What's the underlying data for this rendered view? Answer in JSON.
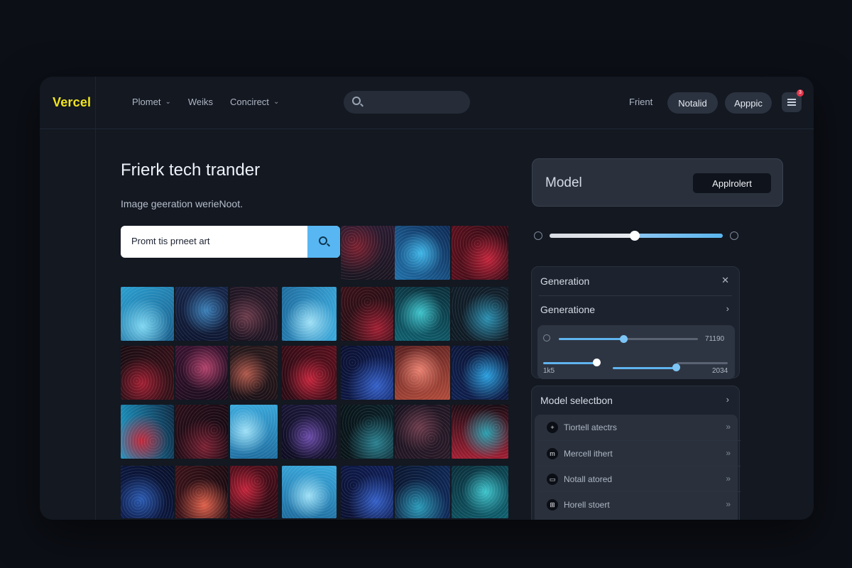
{
  "brand": {
    "name": "Vercel",
    "accent": "#f2e51d"
  },
  "nav": {
    "items": [
      {
        "label": "Plomet",
        "has_menu": true
      },
      {
        "label": "Weiks",
        "has_menu": false
      },
      {
        "label": "Concirect",
        "has_menu": true
      }
    ],
    "chevron": "⌄"
  },
  "header": {
    "search_icon": "search-icon",
    "link_label": "Frient",
    "buttons": [
      {
        "label": "Notalid"
      },
      {
        "label": "Apppic"
      }
    ],
    "menu_badge": "3"
  },
  "hero": {
    "title": "Frierk tech trander",
    "subtitle": "Image geeration werieNoot."
  },
  "prompt": {
    "value": "Promt tis prneet art",
    "submit_icon": "search-icon"
  },
  "gallery": {
    "tiles": [
      "dark-red",
      "cyan-blue",
      "crimson",
      "cyan",
      "navy-cyan",
      "plum",
      "sky",
      "red-dark",
      "teal",
      "dark-cyan",
      "red-dark",
      "magenta",
      "copper",
      "crimson",
      "navy-blue",
      "coral",
      "blue-cyan",
      "red-cyan",
      "maroon",
      "sky",
      "violet",
      "teal-dark",
      "plum",
      "red-teal",
      "navy",
      "coral-red",
      "crimson",
      "sky",
      "navy-blue",
      "blue-teal",
      "teal"
    ]
  },
  "model_card": {
    "label": "Model",
    "button_label": "Applrolert"
  },
  "range": {
    "value": 0.49
  },
  "panel": {
    "rows": [
      {
        "label": "Generation",
        "icon": "close-icon",
        "glyph": "✕"
      },
      {
        "label": "Generatione",
        "icon": "chevron-right-icon",
        "glyph": "›"
      }
    ],
    "slider_1": {
      "value": 0.46,
      "label": "71190"
    },
    "slider_2": {
      "value": 0.6,
      "label": "1k5"
    },
    "slider_3": {
      "value": 0.55,
      "label": "2034"
    }
  },
  "model_selection": {
    "title": "Model selectbon",
    "chevron": "›",
    "items": [
      {
        "icon_glyph": "+",
        "label": "Tiortell atectrs",
        "chevron": "»"
      },
      {
        "icon_glyph": "m",
        "label": "Mercell ithert",
        "chevron": "»"
      },
      {
        "icon_glyph": "▭",
        "label": "Notall atored",
        "chevron": "»"
      },
      {
        "icon_glyph": "⊞",
        "label": "Horell stoert",
        "chevron": "»"
      }
    ]
  }
}
